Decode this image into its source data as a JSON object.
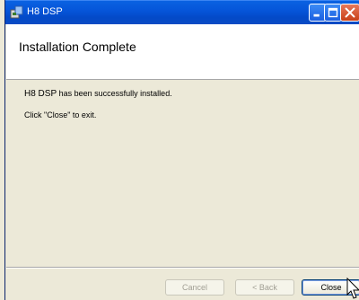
{
  "window": {
    "title": "H8 DSP"
  },
  "header": {
    "title": "Installation Complete"
  },
  "message": {
    "product": "H8 DSP",
    "line1_rest": " has been successfully installed.",
    "line2": "Click \"Close\" to exit."
  },
  "buttons": {
    "cancel": "Cancel",
    "back": "< Back",
    "close": "Close"
  },
  "icons": {
    "app": "installer-icon",
    "minimize": "minimize-icon",
    "maximize": "maximize-icon",
    "close": "close-icon",
    "cursor": "mouse-pointer-icon"
  }
}
